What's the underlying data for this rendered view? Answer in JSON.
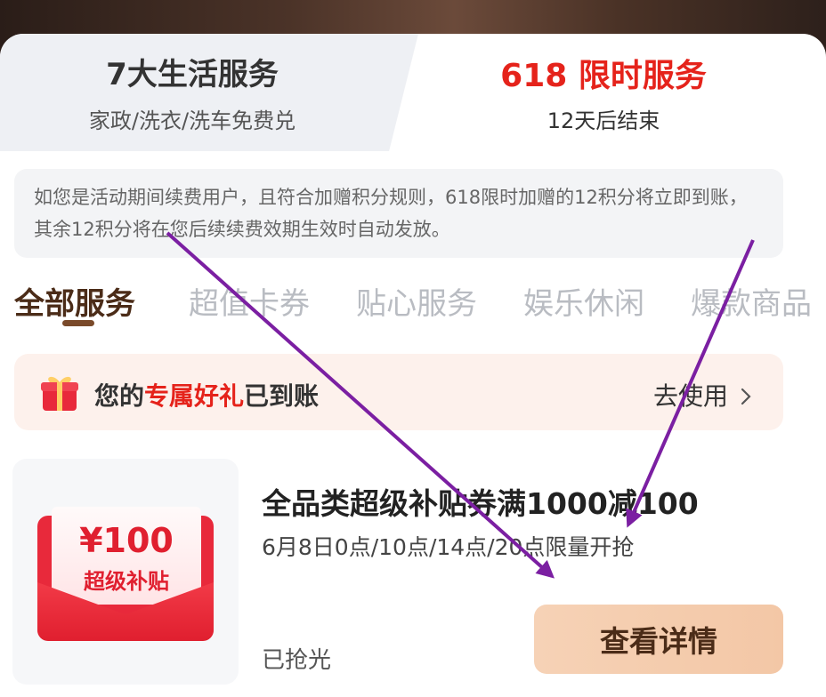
{
  "service_tabs": [
    {
      "title": "7大生活服务",
      "subtitle": "家政/洗衣/洗车免费兑"
    },
    {
      "title": "618 限时服务",
      "subtitle": "12天后结束"
    }
  ],
  "notice": "如您是活动期间续费用户，且符合加赠积分规则，618限时加赠的12积分将立即到账，其余12积分将在您后续续费效期生效时自动发放。",
  "categories": [
    "全部服务",
    "超值卡券",
    "贴心服务",
    "娱乐休闲",
    "爆款商品"
  ],
  "gift_bar": {
    "text_prefix": "您的",
    "text_highlight": "专属好礼",
    "text_suffix": "已到账",
    "action": "去使用",
    "action_icon": "chevron-right-icon"
  },
  "product": {
    "thumb_price": "¥100",
    "thumb_label": "超级补贴",
    "title": "全品类超级补贴券满1000减100",
    "subtitle": "6月8日0点/10点/14点/20点限量开抢",
    "status": "已抢光",
    "button": "查看详情"
  },
  "colors": {
    "accent_red": "#e5231b",
    "brand_brown": "#4b2c18",
    "button_bg": "#f3c7a6",
    "annotation_arrow": "#7b1fa2"
  }
}
